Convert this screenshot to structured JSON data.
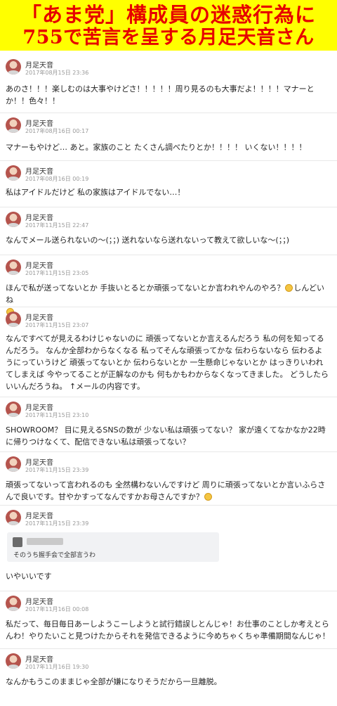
{
  "banner": {
    "line1": "「あま党」構成員の迷惑行為に",
    "line2": "755で苦言を呈する月足天音さん"
  },
  "posts": [
    {
      "username": "月足天音",
      "date": "2017年08月15日 23:36",
      "text": "あのさ！！！楽しむのは大事やけどさ！！！！！周り見るのも大事だよ！！！！マナーとか！！色々！！"
    },
    {
      "username": "月足天音",
      "date": "2017年08月16日 00:17",
      "text": "マナーもやけど… あと。家族のこと たくさん調べたりとか！！！！ いくない！！！！"
    },
    {
      "username": "月足天音",
      "date": "2017年08月16日 00:19",
      "text": "私はアイドルだけど 私の家族はアイドルでない…！"
    },
    {
      "username": "月足天音",
      "date": "2017年11月15日 22:47",
      "text": "なんでメール送られないの〜(；；) 送れないなら送れないって教えて欲しいな〜(；；)"
    },
    {
      "username": "月足天音",
      "date": "2017年11月15日 23:05",
      "text": "ほんで私が送ってないとか 手抜いとるとか頑張ってないとか言われやんのやろ？",
      "text_after": "しんどいね"
    },
    {
      "username": "月足天音",
      "date": "2017年11月15日 23:07",
      "text": "なんですべてが見えるわけじゃないのに 頑張ってないとか言えるんだろう 私の何を知ってるんだろう。 なんか全部わからなくなる 私ってそんな頑張ってかな 伝わらないなら 伝わるようにっていうけど 頑張ってないとか 伝わらないとか 一生懸命じゃないとか はっきりいわれてしまえば 今やってることが正解なのかも 何もかもわからなくなってきました。 どうしたらいいんだろうね。 ↑メールの内容です。"
    },
    {
      "username": "月足天音",
      "date": "2017年11月15日 23:10",
      "text": "SHOWROOM？ 目に見えるSNSの数が 少ない私は頑張ってない？ 家が遠くてなかなか22時に帰りつけなくて、配信できない私は頑張ってない？"
    },
    {
      "username": "月足天音",
      "date": "2017年11月15日 23:39",
      "text": "頑張ってないって言われるのも 全然構わないんですけど 周りに頑張ってないとか言いふらさんで良いです。甘やかすってなんですかお母さんですか？",
      "text_after": ""
    },
    {
      "username": "月足天音",
      "date": "2017年11月15日 23:39",
      "quote": "そのうち握手会で全部言うわ",
      "text": "いやいいです"
    },
    {
      "username": "月足天音",
      "date": "2017年11月16日 00:08",
      "text": "私だって、毎日毎日あーしようこーしようと試行錯誤しとんじゃ！お仕事のことしか考えとらんわ！やりたいこと見つけたからそれを発信できるように今めちゃくちゃ準備期間なんじゃ！"
    },
    {
      "username": "月足天音",
      "date": "2017年11月16日 19:30",
      "text": "なんかもうこのままじゃ全部が嫌になりそうだから一旦離脱。"
    }
  ]
}
